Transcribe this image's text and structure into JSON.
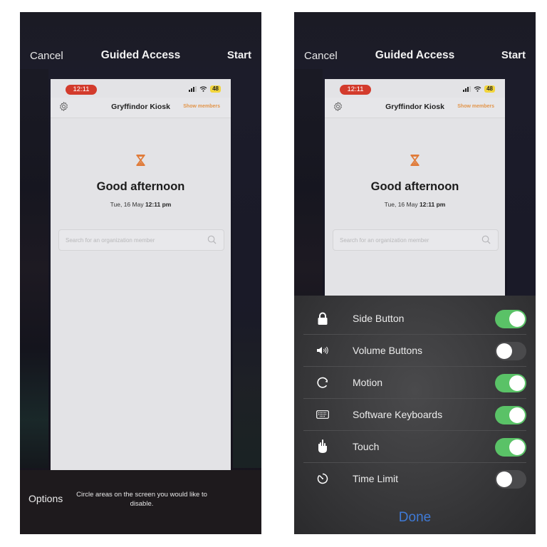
{
  "screens": [
    {
      "id": "left",
      "topbar": {
        "cancel": "Cancel",
        "title": "Guided Access",
        "start": "Start"
      },
      "options": {
        "label": "Options",
        "hint": "Circle areas on the screen you would like to disable."
      }
    },
    {
      "id": "right",
      "topbar": {
        "cancel": "Cancel",
        "title": "Guided Access",
        "start": "Start"
      },
      "options_sheet": {
        "items": [
          {
            "label": "Side Button",
            "icon": "lock-icon",
            "enabled": true
          },
          {
            "label": "Volume Buttons",
            "icon": "speaker-icon",
            "enabled": false
          },
          {
            "label": "Motion",
            "icon": "rotate-icon",
            "enabled": true
          },
          {
            "label": "Software Keyboards",
            "icon": "keyboard-icon",
            "enabled": true
          },
          {
            "label": "Touch",
            "icon": "hand-touch-icon",
            "enabled": true
          },
          {
            "label": "Time Limit",
            "icon": "timer-icon",
            "enabled": false
          }
        ],
        "done": "Done"
      }
    }
  ],
  "app_preview": {
    "status_time": "12:11",
    "battery": "48",
    "app_title": "Gryffindor Kiosk",
    "show_members": "Show members",
    "greeting": "Good afternoon",
    "date": "Tue, 16 May",
    "time": "12:11 pm",
    "search_placeholder": "Search for an organization member"
  },
  "colors": {
    "accent_orange": "#e2954a",
    "status_red": "#d33b2c",
    "toggle_on": "#5ac267",
    "done_blue": "#3f7ad6"
  }
}
